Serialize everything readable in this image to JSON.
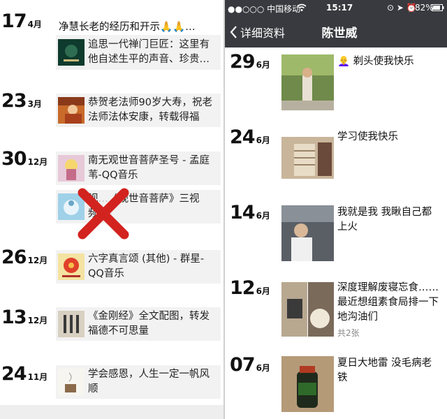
{
  "left": {
    "entries": [
      {
        "day": "17",
        "month": "4月",
        "header_text": "净慧长老的经历和开示🙏🙏…",
        "card_text": "追思一代禅门巨匠：这里有他自述生平的声音、珍贵…"
      },
      {
        "day": "23",
        "month": "3月",
        "card_text": "恭贺老法师90岁大寿，祝老法师法体安康，转载得福"
      },
      {
        "day": "30",
        "month": "12月",
        "card_text": "南无观世音菩萨圣号 - 孟庭苇-QQ音乐",
        "card2_text_a": "视",
        "card2_text_b": "《观世音菩萨》三视",
        "card2_text_c": "频"
      },
      {
        "day": "26",
        "month": "12月",
        "card_text": "六字真言颂 (其他) - 群星-QQ音乐"
      },
      {
        "day": "13",
        "month": "12月",
        "card_text": "《金刚经》全文配图，转发福德不可思量"
      },
      {
        "day": "24",
        "month": "11月",
        "card_text": "学会感恩，人生一定一帆风顺"
      }
    ]
  },
  "right": {
    "status": {
      "carrier": "●●○○○ 中国移动",
      "time": "15:17",
      "battery": "82%"
    },
    "nav": {
      "back_label": "详细资料",
      "title": "陈世威"
    },
    "posts": [
      {
        "day": "29",
        "month": "6月",
        "text": "👩‍🦲 剃头使我快乐"
      },
      {
        "day": "24",
        "month": "6月",
        "text": "学习使我快乐"
      },
      {
        "day": "14",
        "month": "6月",
        "text": "我就是我 我瞅自己都上火"
      },
      {
        "day": "12",
        "month": "6月",
        "text": "深度理解废寝忘食……最近想组素食局排一下地沟油们",
        "sub": "共2张"
      },
      {
        "day": "07",
        "month": "6月",
        "text": "夏日大地雷 没毛病老铁"
      }
    ]
  },
  "colors": {
    "navbar": "#393a3f",
    "card_bg": "#f2f2f2",
    "cross": "#d2231f"
  }
}
